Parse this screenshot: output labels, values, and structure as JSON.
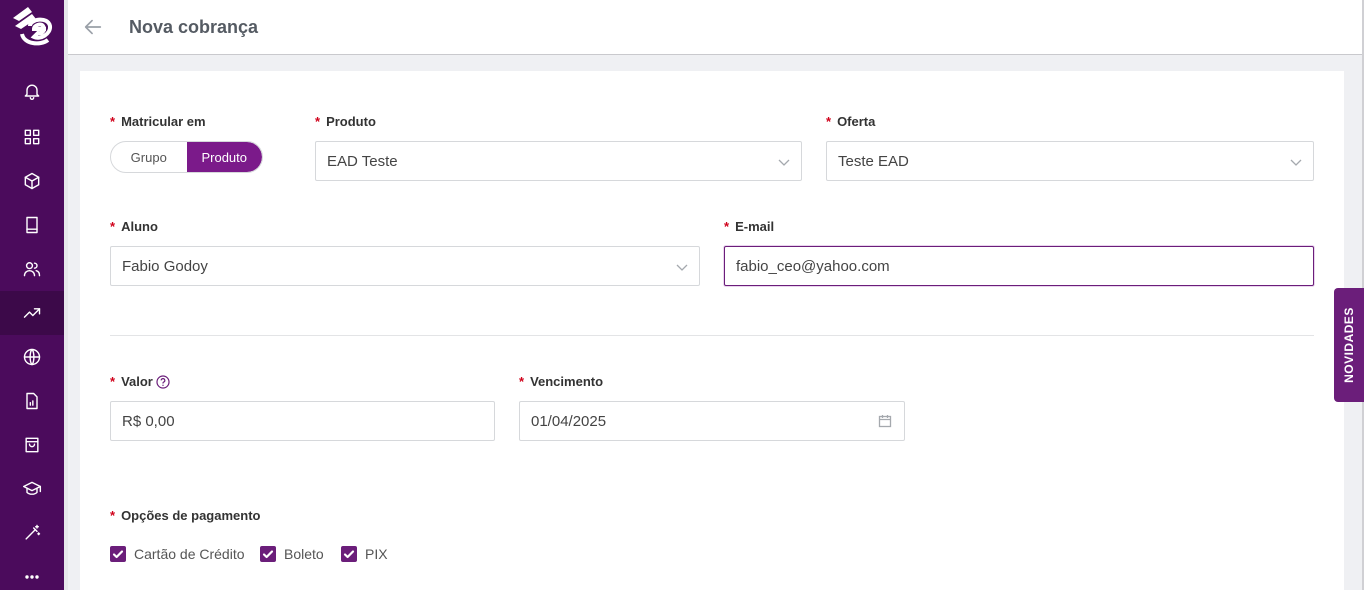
{
  "app": {
    "brand_color": "#4b0b5c",
    "accent_color": "#7b1a8a",
    "required_color": "#d0021b"
  },
  "header": {
    "title": "Nova cobrança",
    "back_icon": "arrow-left-icon"
  },
  "sidebar": {
    "items": [
      {
        "icon": "bell-icon"
      },
      {
        "icon": "grid-icon"
      },
      {
        "icon": "box-icon"
      },
      {
        "icon": "book-icon"
      },
      {
        "icon": "users-icon"
      },
      {
        "icon": "trending-up-icon"
      },
      {
        "icon": "globe-icon"
      },
      {
        "icon": "report-icon"
      },
      {
        "icon": "shopping-bag-icon"
      },
      {
        "icon": "graduation-cap-icon"
      },
      {
        "icon": "magic-wand-icon"
      },
      {
        "icon": "more-icon"
      }
    ]
  },
  "form": {
    "matricular": {
      "label": "Matricular em",
      "options": [
        "Grupo",
        "Produto"
      ],
      "selected": "Produto"
    },
    "produto": {
      "label": "Produto",
      "value": "EAD Teste"
    },
    "oferta": {
      "label": "Oferta",
      "value": "Teste EAD"
    },
    "aluno": {
      "label": "Aluno",
      "value": "Fabio Godoy"
    },
    "email": {
      "label": "E-mail",
      "value": "fabio_ceo@yahoo.com"
    },
    "valor": {
      "label": "Valor",
      "value": "R$ 0,00"
    },
    "vencimento": {
      "label": "Vencimento",
      "value": "01/04/2025"
    },
    "pagamento": {
      "label": "Opções de pagamento",
      "options": [
        {
          "label": "Cartão de Crédito",
          "checked": true
        },
        {
          "label": "Boleto",
          "checked": true
        },
        {
          "label": "PIX",
          "checked": true
        }
      ]
    }
  },
  "novidades": {
    "label": "NOVIDADES"
  }
}
